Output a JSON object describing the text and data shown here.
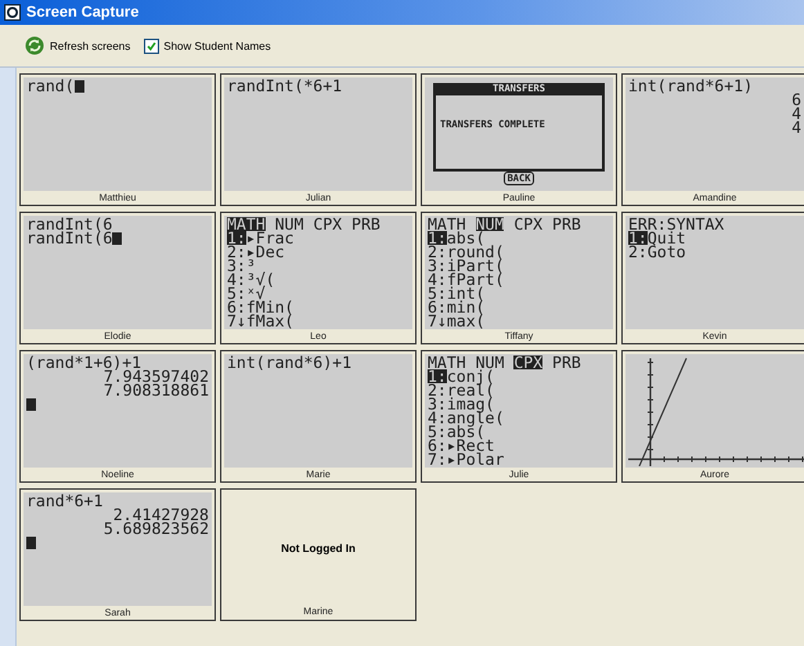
{
  "window": {
    "title": "Screen Capture"
  },
  "toolbar": {
    "refresh_label": "Refresh screens",
    "show_names": {
      "label": "Show Student Names",
      "checked": true
    }
  },
  "tiles": [
    {
      "name": "Matthieu",
      "kind": "home",
      "lines": [
        {
          "spans": [
            {
              "text": "rand(",
              "inverted": false
            }
          ],
          "cursor": true
        }
      ]
    },
    {
      "name": "Julian",
      "kind": "home",
      "lines": [
        {
          "spans": [
            {
              "text": "randInt(*6+1",
              "inverted": false
            }
          ]
        }
      ]
    },
    {
      "name": "Pauline",
      "kind": "dialog",
      "dialog": {
        "title": "TRANSFERS",
        "message": "TRANSFERS COMPLETE",
        "button": "BACK"
      }
    },
    {
      "name": "Amandine",
      "kind": "home",
      "lines": [
        {
          "spans": [
            {
              "text": "int(rand*6+1)",
              "inverted": false
            }
          ]
        },
        {
          "spans": [
            {
              "text": "6",
              "inverted": false
            }
          ],
          "right_aligned": true
        },
        {
          "spans": [
            {
              "text": "4",
              "inverted": false
            }
          ],
          "right_aligned": true
        },
        {
          "spans": [
            {
              "text": "4",
              "inverted": false
            }
          ],
          "right_aligned": true
        }
      ]
    },
    {
      "name": "Elodie",
      "kind": "home",
      "lines": [
        {
          "spans": [
            {
              "text": "randInt(6",
              "inverted": false
            }
          ]
        },
        {
          "spans": [
            {
              "text": "randInt(6",
              "inverted": false
            }
          ],
          "cursor": true
        }
      ]
    },
    {
      "name": "Leo",
      "kind": "home",
      "lines": [
        {
          "spans": [
            {
              "text": "MATH",
              "inverted": true
            },
            {
              "text": " NUM CPX PRB",
              "inverted": false
            }
          ]
        },
        {
          "spans": [
            {
              "text": "1:",
              "inverted": true
            },
            {
              "text": "▸Frac",
              "inverted": false
            }
          ]
        },
        {
          "spans": [
            {
              "text": "2:▸Dec",
              "inverted": false
            }
          ]
        },
        {
          "spans": [
            {
              "text": "3:³",
              "inverted": false
            }
          ]
        },
        {
          "spans": [
            {
              "text": "4:³√(",
              "inverted": false
            }
          ]
        },
        {
          "spans": [
            {
              "text": "5:ˣ√",
              "inverted": false
            }
          ]
        },
        {
          "spans": [
            {
              "text": "6:fMin(",
              "inverted": false
            }
          ]
        },
        {
          "spans": [
            {
              "text": "7↓fMax(",
              "inverted": false
            }
          ]
        }
      ]
    },
    {
      "name": "Tiffany",
      "kind": "home",
      "lines": [
        {
          "spans": [
            {
              "text": "MATH ",
              "inverted": false
            },
            {
              "text": "NUM",
              "inverted": true
            },
            {
              "text": " CPX PRB",
              "inverted": false
            }
          ]
        },
        {
          "spans": [
            {
              "text": "1:",
              "inverted": true
            },
            {
              "text": "abs(",
              "inverted": false
            }
          ]
        },
        {
          "spans": [
            {
              "text": "2:round(",
              "inverted": false
            }
          ]
        },
        {
          "spans": [
            {
              "text": "3:iPart(",
              "inverted": false
            }
          ]
        },
        {
          "spans": [
            {
              "text": "4:fPart(",
              "inverted": false
            }
          ]
        },
        {
          "spans": [
            {
              "text": "5:int(",
              "inverted": false
            }
          ]
        },
        {
          "spans": [
            {
              "text": "6:min(",
              "inverted": false
            }
          ]
        },
        {
          "spans": [
            {
              "text": "7↓max(",
              "inverted": false
            }
          ]
        }
      ]
    },
    {
      "name": "Kevin",
      "kind": "home",
      "lines": [
        {
          "spans": [
            {
              "text": "ERR:SYNTAX",
              "inverted": false
            }
          ]
        },
        {
          "spans": [
            {
              "text": "1:",
              "inverted": true
            },
            {
              "text": "Quit",
              "inverted": false
            }
          ]
        },
        {
          "spans": [
            {
              "text": "2:Goto",
              "inverted": false
            }
          ]
        }
      ]
    },
    {
      "name": "Noeline",
      "kind": "home",
      "lines": [
        {
          "spans": [
            {
              "text": "(rand*1+6)+1",
              "inverted": false
            }
          ]
        },
        {
          "spans": [
            {
              "text": "7.943597402",
              "inverted": false
            }
          ],
          "right_aligned": true
        },
        {
          "spans": [
            {
              "text": "7.908318861",
              "inverted": false
            }
          ],
          "right_aligned": true
        },
        {
          "cursor": true
        }
      ]
    },
    {
      "name": "Marie",
      "kind": "home",
      "lines": [
        {
          "spans": [
            {
              "text": "int(rand*6)+1",
              "inverted": false
            }
          ]
        }
      ]
    },
    {
      "name": "Julie",
      "kind": "home",
      "lines": [
        {
          "spans": [
            {
              "text": "MATH NUM ",
              "inverted": false
            },
            {
              "text": "CPX",
              "inverted": true
            },
            {
              "text": " PRB",
              "inverted": false
            }
          ]
        },
        {
          "spans": [
            {
              "text": "1:",
              "inverted": true
            },
            {
              "text": "conj(",
              "inverted": false
            }
          ]
        },
        {
          "spans": [
            {
              "text": "2:real(",
              "inverted": false
            }
          ]
        },
        {
          "spans": [
            {
              "text": "3:imag(",
              "inverted": false
            }
          ]
        },
        {
          "spans": [
            {
              "text": "4:angle(",
              "inverted": false
            }
          ]
        },
        {
          "spans": [
            {
              "text": "5:abs(",
              "inverted": false
            }
          ]
        },
        {
          "spans": [
            {
              "text": "6:▸Rect",
              "inverted": false
            }
          ]
        },
        {
          "spans": [
            {
              "text": "7:▸Polar",
              "inverted": false
            }
          ]
        }
      ]
    },
    {
      "name": "Aurore",
      "kind": "graph"
    },
    {
      "name": "Sarah",
      "kind": "home",
      "lines": [
        {
          "spans": [
            {
              "text": "rand*6+1",
              "inverted": false
            }
          ]
        },
        {
          "spans": [
            {
              "text": "2.41427928",
              "inverted": false
            }
          ],
          "right_aligned": true
        },
        {
          "spans": [
            {
              "text": "5.689823562",
              "inverted": false
            }
          ],
          "right_aligned": true
        },
        {
          "cursor": true
        }
      ]
    },
    {
      "name": "Marine",
      "kind": "offline",
      "message": "Not Logged In"
    }
  ]
}
